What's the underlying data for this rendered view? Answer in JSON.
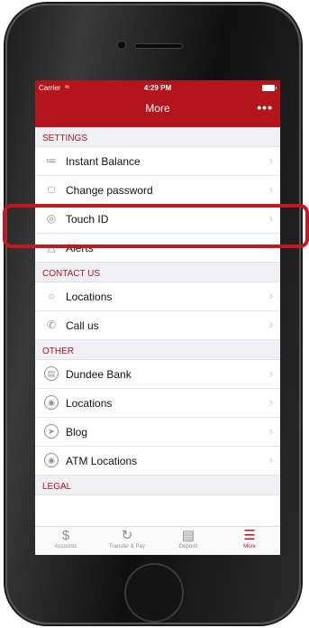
{
  "status_bar": {
    "carrier": "Carrier",
    "time": "4:29 PM"
  },
  "nav": {
    "title": "More",
    "menu_glyph": "•••"
  },
  "sections": {
    "settings": {
      "title": "SETTINGS",
      "items": [
        {
          "label": "Instant Balance",
          "icon": "instant-balance-icon"
        },
        {
          "label": "Change password",
          "icon": "lock-icon"
        },
        {
          "label": "Touch ID",
          "icon": "fingerprint-icon"
        },
        {
          "label": "Alerts",
          "icon": "bell-icon"
        }
      ]
    },
    "contact": {
      "title": "CONTACT US",
      "items": [
        {
          "label": "Locations",
          "icon": "location-pin-icon"
        },
        {
          "label": "Call us",
          "icon": "phone-icon"
        }
      ]
    },
    "other": {
      "title": "OTHER",
      "items": [
        {
          "label": "Dundee Bank",
          "icon": "bank-icon"
        },
        {
          "label": "Locations",
          "icon": "location-pin-icon"
        },
        {
          "label": "Blog",
          "icon": "blog-icon"
        },
        {
          "label": "ATM Locations",
          "icon": "atm-location-icon"
        }
      ]
    },
    "legal": {
      "title": "LEGAL"
    }
  },
  "tabbar": {
    "tabs": [
      {
        "label": "Accounts",
        "icon": "dollar-icon"
      },
      {
        "label": "Transfer & Pay",
        "icon": "transfer-icon"
      },
      {
        "label": "Deposit",
        "icon": "deposit-check-icon"
      },
      {
        "label": "More",
        "icon": "hamburger-menu-icon",
        "active": true
      }
    ]
  },
  "colors": {
    "brand": "#b4141b",
    "highlight": "#c8161f"
  }
}
